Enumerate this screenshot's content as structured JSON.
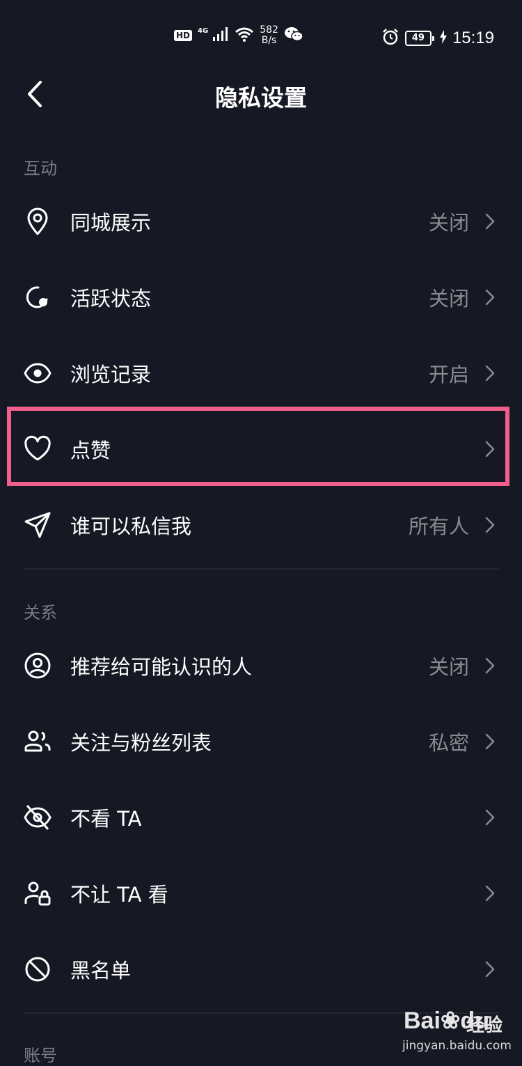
{
  "status_bar": {
    "hd": "HD",
    "network": "4G",
    "speed_value": "582",
    "speed_unit": "B/s",
    "battery": "49",
    "time": "15:19",
    "icons": [
      "hd-badge",
      "signal-icon",
      "wifi-icon",
      "wechat-icon",
      "alarm-icon",
      "battery-icon",
      "charging-icon"
    ]
  },
  "header": {
    "title": "隐私设置"
  },
  "sections": {
    "interaction": {
      "title": "互动",
      "items": [
        {
          "label": "同城展示",
          "value": "关闭",
          "icon": "location-pin-icon"
        },
        {
          "label": "活跃状态",
          "value": "关闭",
          "icon": "active-status-icon"
        },
        {
          "label": "浏览记录",
          "value": "开启",
          "icon": "eye-icon"
        },
        {
          "label": "点赞",
          "value": "",
          "icon": "heart-icon"
        },
        {
          "label": "谁可以私信我",
          "value": "所有人",
          "icon": "send-icon"
        }
      ]
    },
    "relations": {
      "title": "关系",
      "items": [
        {
          "label": "推荐给可能认识的人",
          "value": "关闭",
          "icon": "user-circle-icon"
        },
        {
          "label": "关注与粉丝列表",
          "value": "私密",
          "icon": "users-icon"
        },
        {
          "label": "不看 TA",
          "value": "",
          "icon": "eye-off-icon"
        },
        {
          "label": "不让 TA 看",
          "value": "",
          "icon": "user-lock-icon"
        },
        {
          "label": "黑名单",
          "value": "",
          "icon": "block-icon"
        }
      ]
    },
    "account": {
      "title": "账号"
    }
  },
  "watermark": {
    "logo": "Bai",
    "logo_tail": "du",
    "brand": "经验",
    "url": "jingyan.baidu.com"
  },
  "colors": {
    "background": "#161823",
    "highlight": "#f25f8c",
    "value_text": "#8a8b91",
    "section_text": "#7c7e85"
  }
}
